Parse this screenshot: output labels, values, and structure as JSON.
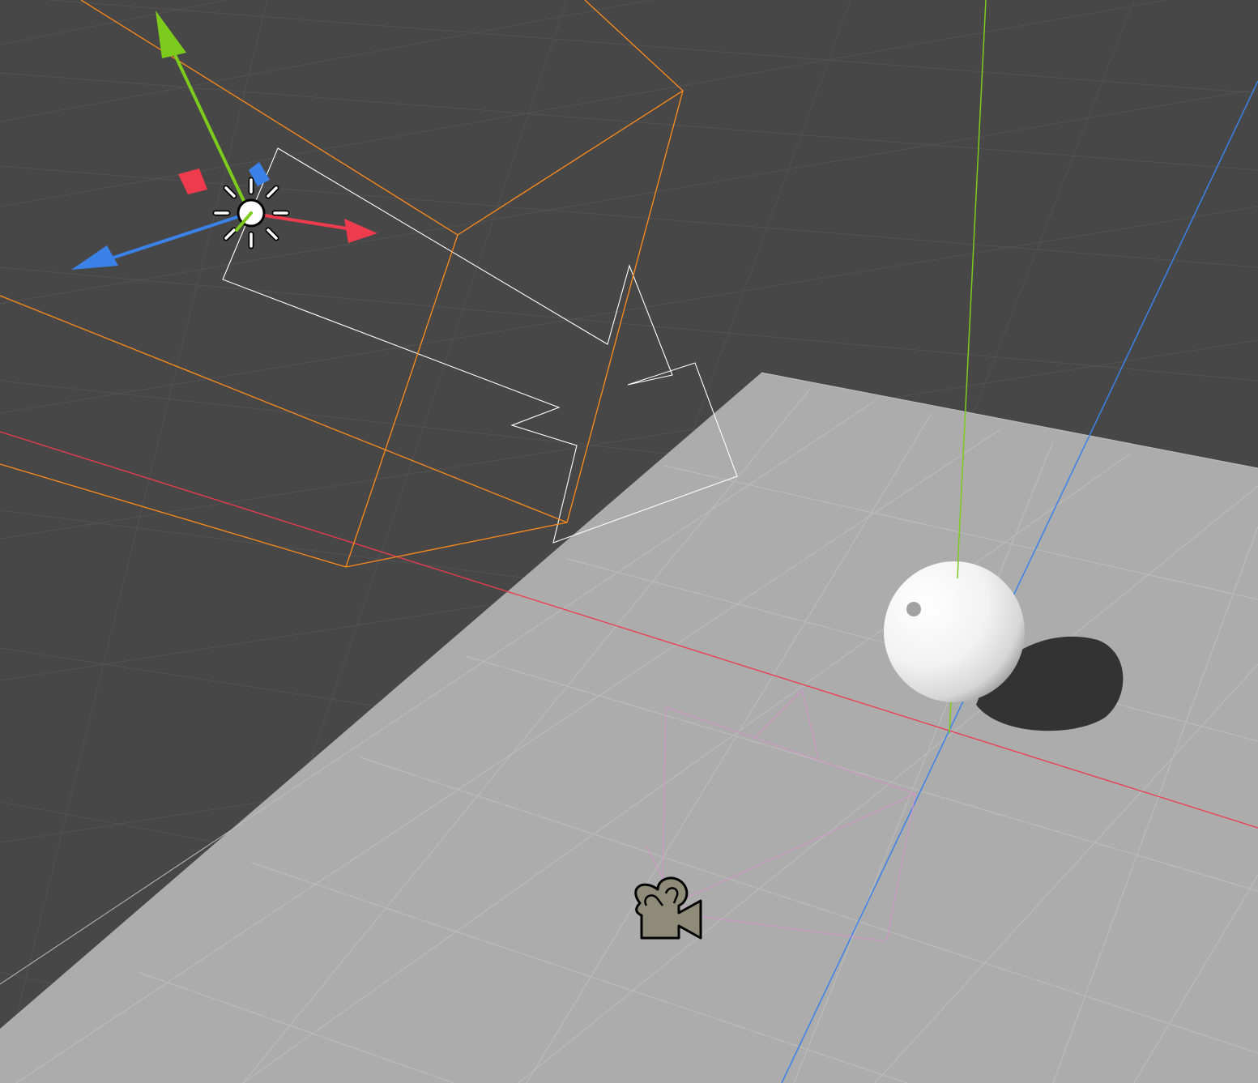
{
  "viewport": {
    "background_color": "#474747",
    "grid_color_dark": "#525252",
    "grid_color_light": "#bdbdbd",
    "ground_plane_color": "#acacac",
    "axis_colors": {
      "x": "#ee3b4e",
      "y": "#7ccb1d",
      "z": "#3b82e8"
    }
  },
  "objects": {
    "directional_light": {
      "icon": "sun-icon",
      "selected": true,
      "selection_color": "#ff8c1a",
      "wire_color": "#ffffff"
    },
    "sphere": {
      "color": "#f2f2f2",
      "shadow_color": "#333333"
    },
    "camera": {
      "icon": "camera-icon",
      "icon_color": "#8e8c78",
      "frustum_color": "#d990d0"
    }
  },
  "transform_gizmo": {
    "handles": [
      "x-axis-arrow",
      "y-axis-arrow",
      "z-axis-arrow",
      "xy-plane-handle",
      "yz-plane-handle"
    ]
  }
}
